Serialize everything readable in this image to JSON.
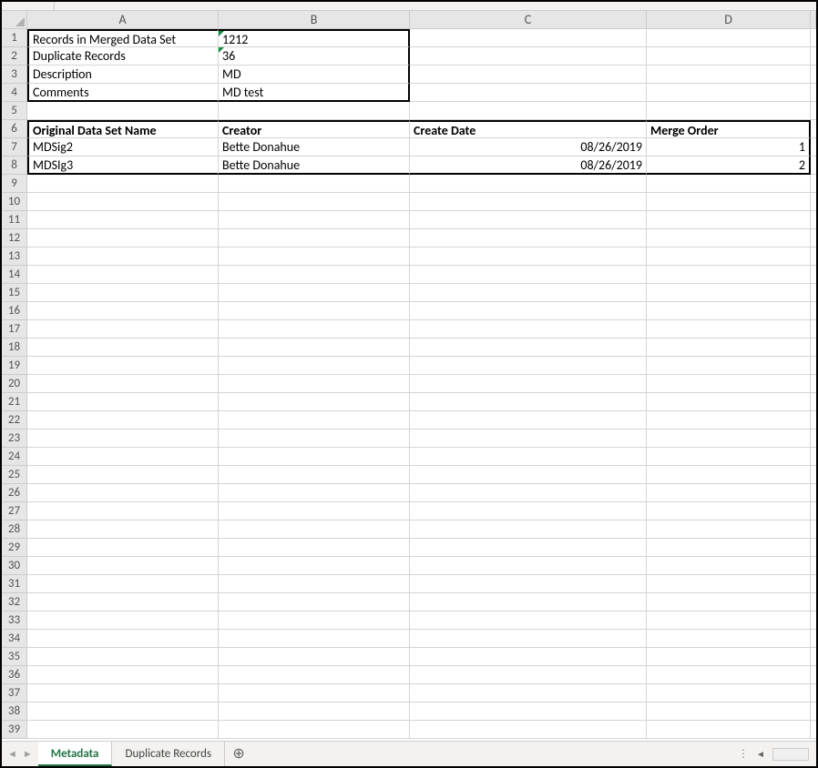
{
  "columns": [
    "A",
    "B",
    "C",
    "D"
  ],
  "summary": {
    "records_label": "Records in Merged Data Set",
    "records_value": "1212",
    "dup_label": "Duplicate Records",
    "dup_value": "36",
    "desc_label": "Description",
    "desc_value": "MD",
    "comments_label": "Comments",
    "comments_value": "MD test"
  },
  "table_header": {
    "a": "Original Data Set Name",
    "b": "Creator",
    "c": "Create Date",
    "d": "Merge Order"
  },
  "rows": [
    {
      "a": "MDSig2",
      "b": "Bette Donahue",
      "c": "08/26/2019",
      "d": "1"
    },
    {
      "a": "MDSIg3",
      "b": "Bette Donahue",
      "c": "08/26/2019",
      "d": "2"
    }
  ],
  "tabs": {
    "active": "Metadata",
    "other": "Duplicate Records"
  }
}
